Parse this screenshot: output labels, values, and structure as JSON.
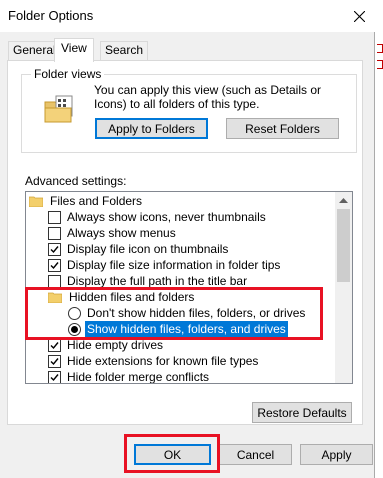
{
  "window": {
    "title": "Folder Options"
  },
  "tabs": [
    {
      "label": "General",
      "active": false
    },
    {
      "label": "View",
      "active": true
    },
    {
      "label": "Search",
      "active": false
    }
  ],
  "folder_views": {
    "group_label": "Folder views",
    "description": "You can apply this view (such as Details or Icons) to all folders of this type.",
    "apply_button": "Apply to Folders",
    "reset_button": "Reset Folders"
  },
  "advanced": {
    "label": "Advanced settings:",
    "items": [
      {
        "type": "folder",
        "label": "Files and Folders"
      },
      {
        "type": "checkbox",
        "label": "Always show icons, never thumbnails",
        "checked": false
      },
      {
        "type": "checkbox",
        "label": "Always show menus",
        "checked": false
      },
      {
        "type": "checkbox",
        "label": "Display file icon on thumbnails",
        "checked": true
      },
      {
        "type": "checkbox",
        "label": "Display file size information in folder tips",
        "checked": true
      },
      {
        "type": "checkbox",
        "label": "Display the full path in the title bar",
        "checked": false
      },
      {
        "type": "folder",
        "label": "Hidden files and folders"
      },
      {
        "type": "radio",
        "label": "Don't show hidden files, folders, or drives",
        "checked": false
      },
      {
        "type": "radio",
        "label": "Show hidden files, folders, and drives",
        "checked": true,
        "selected": true
      },
      {
        "type": "checkbox",
        "label": "Hide empty drives",
        "checked": true
      },
      {
        "type": "checkbox",
        "label": "Hide extensions for known file types",
        "checked": true
      },
      {
        "type": "checkbox",
        "label": "Hide folder merge conflicts",
        "checked": true
      }
    ],
    "restore_button": "Restore Defaults"
  },
  "footer": {
    "ok": "OK",
    "cancel": "Cancel",
    "apply": "Apply"
  },
  "colors": {
    "accent": "#0078d7",
    "highlight_box": "#e81123"
  }
}
